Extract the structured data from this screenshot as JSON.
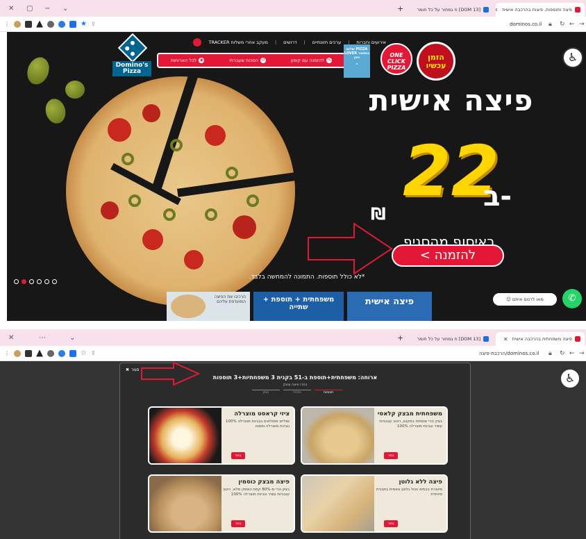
{
  "top": {
    "browser": {
      "tab_active": "פיצה ותוספות, פיצות בהרכבה אישית",
      "tab_other": "[DOM 13] ח גמחור על כל חומר",
      "url": "dominos.co.il",
      "window_controls": [
        "✕",
        "⌄"
      ]
    },
    "site": {
      "logo_text": "Domino's Pizza",
      "top_menu": [
        "אירועים וחברות",
        "ערכים תזונתיים",
        "דרושים",
        "מעקב אחרי משלוח TRACKER"
      ],
      "red_bar": [
        "להזמנה עם קופון",
        "הסכות שעברתי",
        "לכל הארוחות"
      ],
      "lover_badge": "שלום PIZZA LOVER התחבר כאן",
      "one_badge": "ONE CLICK PIZZA",
      "order_badge": "הזמן עכשיו",
      "headline": "פיצה אישית",
      "big_price": "22",
      "price_prefix": "ב-",
      "currency": "₪",
      "pickup_text": "באיסוף מהסניף",
      "order_button": "להזמנה >",
      "disclaimer": "*לא כולל תוספות. התמונה להמחשה בלבד.",
      "carousel_dots": 6,
      "carousel_active": 1,
      "card_family": "משפחתית + תוספת + שתייה",
      "card_personal": "פיצה אישית",
      "card_text": "הרכיבו את הפיצה המועדפת עליכם",
      "chat_bubble": "מאו לרנוס איתם",
      "accessibility_icon": "♿"
    }
  },
  "bottom": {
    "browser": {
      "tab_active": "פיצה משפחתית בהרכבה אישית",
      "tab_other": "[DOM 13] ח גמחור על כל חומר",
      "url": "dominos.co.il/הרכבת-פיצה"
    },
    "dialog": {
      "title": "ארוחה: משפחתית+תוספת ב-51 בקנית 3 משפחתיות+3 תוספות",
      "subtitle": "בחרו פיצה ובצק",
      "steps": [
        "בצק",
        "בחירה",
        "תוספות"
      ],
      "close_label": "סגור",
      "options": [
        {
          "title": "משפחתית מבצק קלאסי",
          "desc": "בצק טרי שנפתח במקום, רוטב עגבניות עשיר וגבינת מוצרלה 100%",
          "button": "בחר"
        },
        {
          "title": "ציזי קראסט מוצרלה",
          "desc": "שוליים ממולאים בגבינת מוצרלה 100% וגבינת מוצרלה ופסטו",
          "button": "בחר"
        },
        {
          "title": "פיצה ללא גלוטן",
          "desc": "מיוצרת בבסיס נטול גלוטן ונאפית בתבנית מיוחדת",
          "button": "בחר"
        },
        {
          "title": "פיצה מבצק כוסמין",
          "desc": "בצק טרי מ-80% קמח כוסמין מלא, רוטב עגבניות עשיר וגבינת מוצרלה 100%",
          "button": "בחר"
        }
      ]
    }
  },
  "colors": {
    "brand_red": "#e31837",
    "brand_blue": "#006491",
    "price_yellow": "#ffd500"
  }
}
